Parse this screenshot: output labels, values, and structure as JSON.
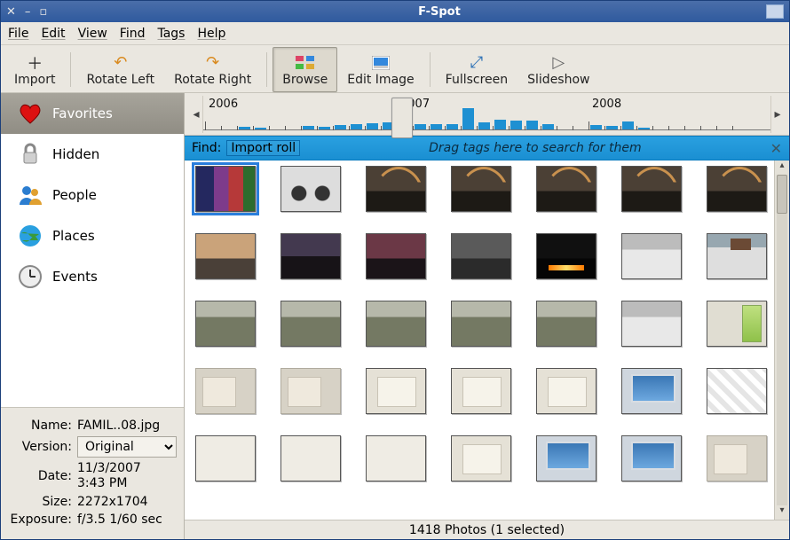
{
  "window": {
    "title": "F-Spot"
  },
  "menu": {
    "file": "File",
    "edit": "Edit",
    "view": "View",
    "find": "Find",
    "tags": "Tags",
    "help": "Help"
  },
  "toolbar": {
    "import": "Import",
    "rotate_left": "Rotate Left",
    "rotate_right": "Rotate Right",
    "browse": "Browse",
    "edit_image": "Edit Image",
    "fullscreen": "Fullscreen",
    "slideshow": "Slideshow"
  },
  "tags": {
    "items": [
      {
        "name": "favorites",
        "label": "Favorites"
      },
      {
        "name": "hidden",
        "label": "Hidden"
      },
      {
        "name": "people",
        "label": "People"
      },
      {
        "name": "places",
        "label": "Places"
      },
      {
        "name": "events",
        "label": "Events"
      }
    ],
    "selected_index": 0
  },
  "meta": {
    "name_label": "Name:",
    "name_value": "FAMIL..08.jpg",
    "version_label": "Version:",
    "version_value": "Original",
    "date_label": "Date:",
    "date_value": "11/3/2007 3:43 PM",
    "size_label": "Size:",
    "size_value": "2272x1704",
    "exposure_label": "Exposure:",
    "exposure_value": "f/3.5 1/60 sec"
  },
  "timeline": {
    "years": [
      "2006",
      "2007",
      "2008"
    ],
    "bars": [
      0,
      0,
      3,
      2,
      0,
      0,
      4,
      3,
      5,
      6,
      7,
      8,
      5,
      6,
      6,
      6,
      24,
      8,
      11,
      10,
      10,
      6,
      0,
      0,
      5,
      4,
      9,
      2,
      0,
      0,
      0,
      0,
      0,
      0
    ],
    "handle_index": 12
  },
  "findbar": {
    "label": "Find:",
    "roll": "Import roll",
    "hint": "Drag tags here to search for them"
  },
  "grid": {
    "rows": [
      [
        "books",
        "bike",
        "rainbow",
        "rainbow",
        "rainbow",
        "rainbow",
        "rainbow"
      ],
      [
        "sunset1",
        "sunset2",
        "sunset3",
        "dusk",
        "fire",
        "snowday",
        "snowhouse"
      ],
      [
        "garden",
        "garden",
        "garden",
        "garden",
        "garden",
        "snowday",
        "router"
      ],
      [
        "box",
        "box",
        "macbook",
        "macbook",
        "macbook",
        "screen",
        "quilt"
      ],
      [
        "cables",
        "cables",
        "cables",
        "macbook",
        "screen",
        "screen",
        "box"
      ]
    ],
    "selected": {
      "row": 0,
      "col": 0
    }
  },
  "status": {
    "text": "1418 Photos (1 selected)"
  }
}
